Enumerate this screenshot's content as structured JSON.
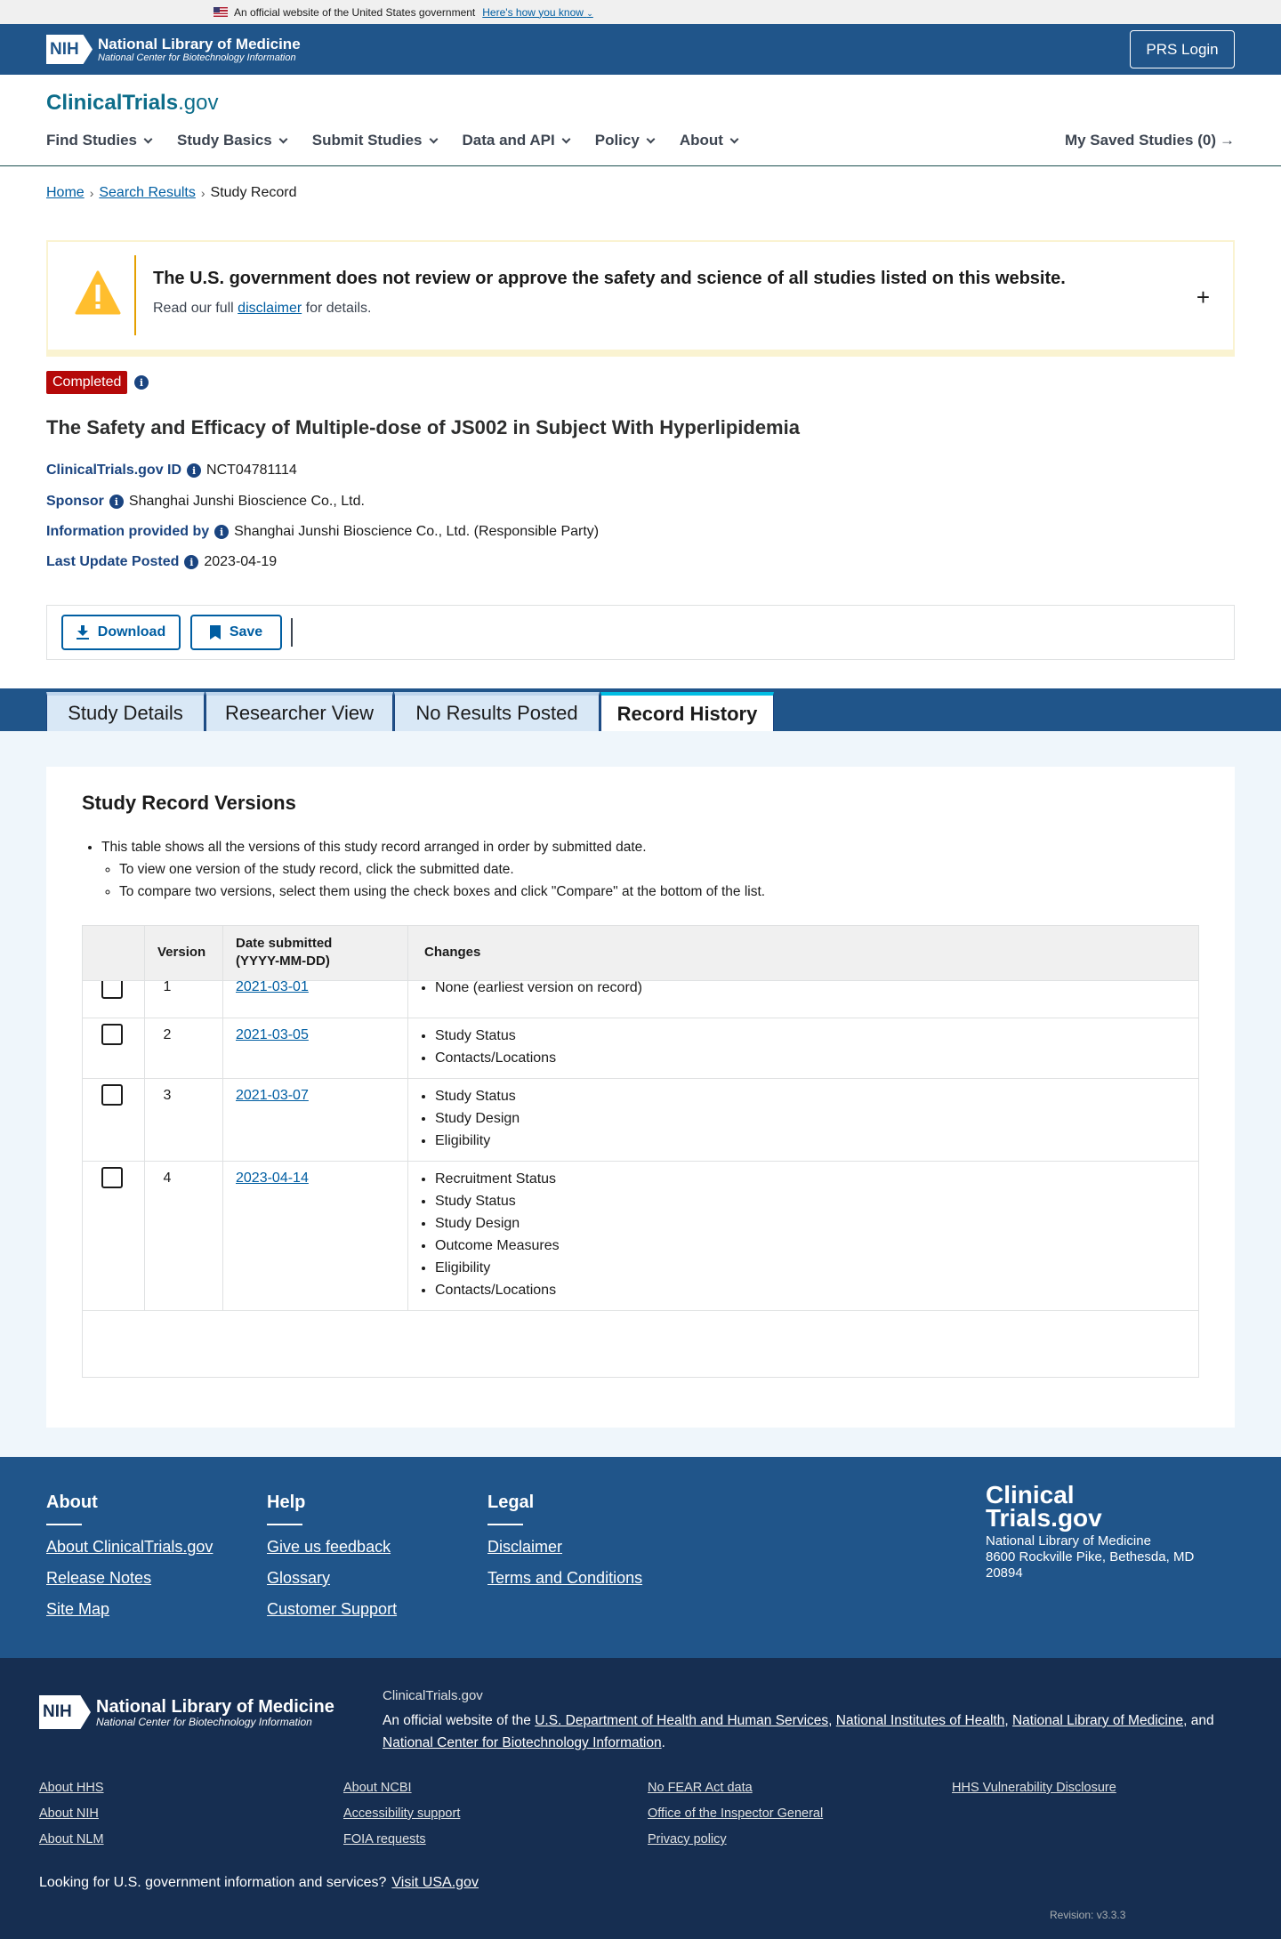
{
  "gov_banner": {
    "text": "An official website of the United States government",
    "link": "Here's how you know"
  },
  "nlm": {
    "title": "National Library of Medicine",
    "subtitle": "National Center for Biotechnology Information",
    "nih": "NIH",
    "login": "PRS Login"
  },
  "site": {
    "logo_main": "ClinicalTrials",
    "logo_tld": ".gov"
  },
  "nav": {
    "items": [
      "Find Studies",
      "Study Basics",
      "Submit Studies",
      "Data and API",
      "Policy",
      "About"
    ],
    "saved": "My Saved Studies (0)"
  },
  "breadcrumb": {
    "home": "Home",
    "search": "Search Results",
    "current": "Study Record"
  },
  "disclaimer": {
    "title": "The U.S. government does not review or approve the safety and science of all studies listed on this website.",
    "text_before": "Read our full ",
    "link": "disclaimer",
    "text_after": " for details."
  },
  "study": {
    "status": "Completed",
    "title": "The Safety and Efficacy of Multiple-dose of JS002 in Subject With Hyperlipidemia",
    "id_label": "ClinicalTrials.gov ID",
    "id": "NCT04781114",
    "sponsor_label": "Sponsor",
    "sponsor": "Shanghai Junshi Bioscience Co., Ltd.",
    "info_label": "Information provided by",
    "info": "Shanghai Junshi Bioscience Co., Ltd. (Responsible Party)",
    "update_label": "Last Update Posted",
    "update": "2023-04-19"
  },
  "actions": {
    "download": "Download",
    "save": "Save"
  },
  "tabs": [
    "Study Details",
    "Researcher View",
    "No Results Posted",
    "Record History"
  ],
  "versions": {
    "title": "Study Record Versions",
    "intro": "This table shows all the versions of this study record arranged in order by submitted date.",
    "sub1": "To view one version of the study record, click the submitted date.",
    "sub2": "To compare two versions, select them using the check boxes and click \"Compare\" at the bottom of the list.",
    "col_version": "Version",
    "col_date_1": "Date submitted",
    "col_date_2": "(YYYY-MM-DD)",
    "col_changes": "Changes",
    "rows": [
      {
        "version": "1",
        "date": "2021-03-01",
        "changes": [
          "None (earliest version on record)"
        ]
      },
      {
        "version": "2",
        "date": "2021-03-05",
        "changes": [
          "Study Status",
          "Contacts/Locations"
        ]
      },
      {
        "version": "3",
        "date": "2021-03-07",
        "changes": [
          "Study Status",
          "Study Design",
          "Eligibility"
        ]
      },
      {
        "version": "4",
        "date": "2023-04-14",
        "changes": [
          "Recruitment Status",
          "Study Status",
          "Study Design",
          "Outcome Measures",
          "Eligibility",
          "Contacts/Locations"
        ]
      }
    ]
  },
  "footer": {
    "about_h": "About",
    "about_links": [
      "About ClinicalTrials.gov",
      "Release Notes",
      "Site Map"
    ],
    "help_h": "Help",
    "help_links": [
      "Give us feedback",
      "Glossary",
      "Customer Support"
    ],
    "legal_h": "Legal",
    "legal_links": [
      "Disclaimer",
      "Terms and Conditions"
    ],
    "logo_l1": "Clinical",
    "logo_l2": "Trials.gov",
    "addr1": "National Library of Medicine",
    "addr2": "8600 Rockville Pike, Bethesda, MD 20894",
    "site_label": "ClinicalTrials.gov",
    "official_prefix": "An official website of the ",
    "agency1": "U.S. Department of Health and Human Services",
    "agency2": "National Institutes of Health",
    "agency3": "National Library of Medicine",
    "agency4": "National Center for Biotechnology Information",
    "links_col1": [
      "About HHS",
      "About NIH",
      "About NLM"
    ],
    "links_col2": [
      "About NCBI",
      "Accessibility support",
      "FOIA requests"
    ],
    "links_col3": [
      "No FEAR Act data",
      "Office of the Inspector General",
      "Privacy policy"
    ],
    "links_col4": [
      "HHS Vulnerability Disclosure"
    ],
    "usa_text": "Looking for U.S. government information and services?",
    "usa_link": "Visit USA.gov",
    "revision": "Revision: v3.3.3"
  }
}
